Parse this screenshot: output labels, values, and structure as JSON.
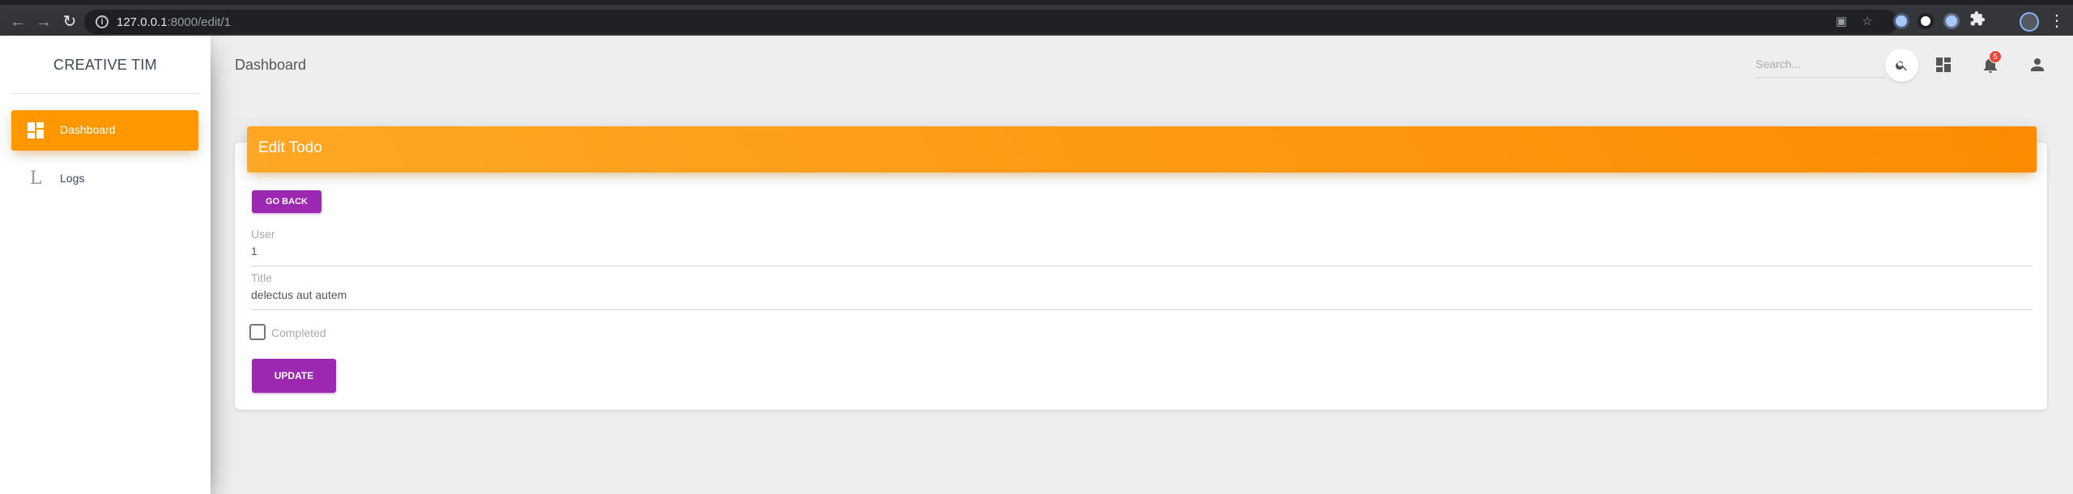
{
  "browser": {
    "url_host": "127.0.0.1",
    "url_path": ":8000/edit/1"
  },
  "sidebar": {
    "brand": "CREATIVE TIM",
    "items": [
      {
        "label": "Dashboard",
        "icon": "dashboard-icon",
        "active": true
      },
      {
        "label": "Logs",
        "icon_letter": "L",
        "active": false
      }
    ]
  },
  "navbar": {
    "title": "Dashboard",
    "search_placeholder": "Search...",
    "notification_count": "5"
  },
  "card": {
    "header_title": "Edit Todo",
    "go_back_label": "GO BACK",
    "fields": {
      "user": {
        "label": "User",
        "value": "1"
      },
      "title": {
        "label": "Title",
        "value": "delectus aut autem"
      }
    },
    "completed_label": "Completed",
    "completed_checked": false,
    "update_label": "UPDATE"
  },
  "colors": {
    "accent_orange": "#ff9800",
    "button_purple": "#9c27b0",
    "badge_red": "#f44336"
  }
}
